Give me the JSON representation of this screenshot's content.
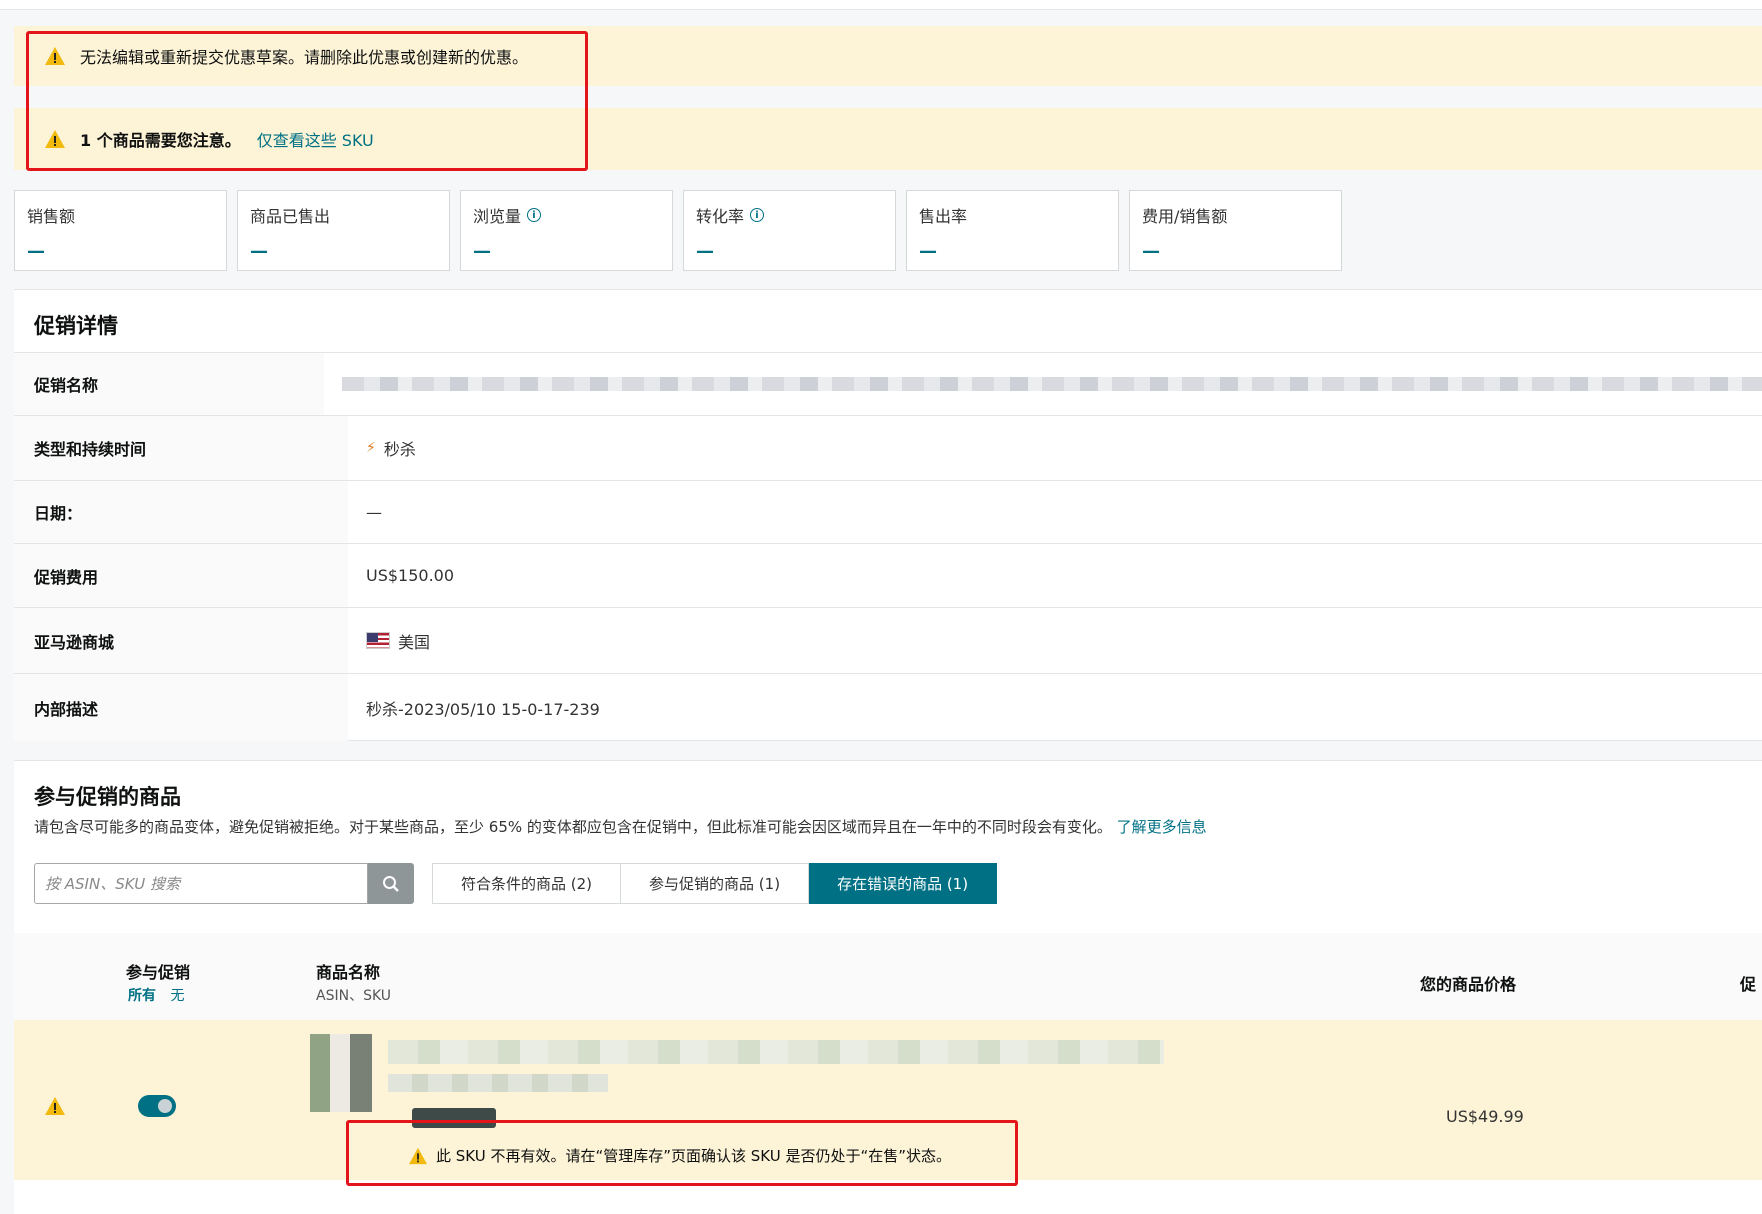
{
  "alerts": {
    "draft_warning": "无法编辑或重新提交优惠草案。请删除此优惠或创建新的优惠。",
    "attention_bold": "1 个商品需要您注意。",
    "attention_link": "仅查看这些 SKU"
  },
  "metrics": [
    {
      "label": "销售额",
      "value": "—",
      "info": false
    },
    {
      "label": "商品已售出",
      "value": "—",
      "info": false
    },
    {
      "label": "浏览量",
      "value": "—",
      "info": true
    },
    {
      "label": "转化率",
      "value": "—",
      "info": true
    },
    {
      "label": "售出率",
      "value": "—",
      "info": false
    },
    {
      "label": "费用/销售额",
      "value": "—",
      "info": false
    }
  ],
  "details": {
    "title": "促销详情",
    "rows": {
      "name_label": "促销名称",
      "type_label": "类型和持续时间",
      "type_value": "秒杀",
      "date_label": "日期：",
      "date_value": "—",
      "fee_label": "促销费用",
      "fee_value": "US$150.00",
      "market_label": "亚马逊商城",
      "market_value": "美国",
      "desc_label": "内部描述",
      "desc_value": "秒杀-2023/05/10 15-0-17-239"
    }
  },
  "products": {
    "title": "参与促销的商品",
    "description": "请包含尽可能多的商品变体，避免促销被拒绝。对于某些商品，至少 65% 的变体都应包含在促销中，但此标准可能会因区域而异且在一年中的不同时段会有变化。",
    "learn_more": "了解更多信息",
    "search_placeholder": "按 ASIN、SKU 搜索",
    "tabs": {
      "eligible": "符合条件的商品 (2)",
      "participating": "参与促销的商品 (1)",
      "errors": "存在错误的商品 (1)"
    },
    "table": {
      "col_participate": "参与促销",
      "filter_all": "所有",
      "filter_none": "无",
      "col_name": "商品名称",
      "col_name_sub": "ASIN、SKU",
      "col_price": "您的商品价格",
      "col_cut": "促"
    },
    "row": {
      "price": "US$49.99",
      "error_message": "此 SKU 不再有效。请在“管理库存”页面确认该 SKU 是否仍处于“在售”状态。"
    }
  },
  "colors": {
    "accent": "#007185",
    "warning_bg": "#fdf3d6",
    "highlight_border": "#e4141b"
  }
}
